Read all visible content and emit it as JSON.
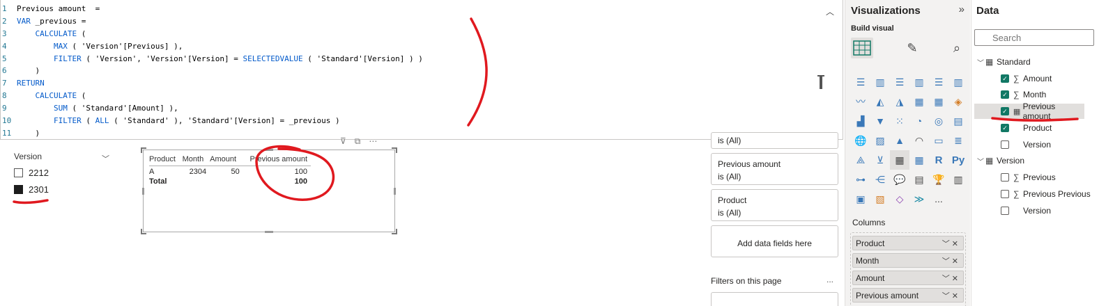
{
  "editor": {
    "lines": [
      {
        "n": "1",
        "parts": [
          [
            "t",
            "Previous amount  ="
          ]
        ]
      },
      {
        "n": "2",
        "parts": [
          [
            "kw",
            "VAR"
          ],
          [
            "t",
            " _previous ="
          ]
        ]
      },
      {
        "n": "3",
        "parts": [
          [
            "t",
            "    "
          ],
          [
            "fn",
            "CALCULATE"
          ],
          [
            "t",
            " ("
          ]
        ]
      },
      {
        "n": "4",
        "parts": [
          [
            "t",
            "        "
          ],
          [
            "fn",
            "MAX"
          ],
          [
            "t",
            " ( 'Version'[Previous] ),"
          ]
        ]
      },
      {
        "n": "5",
        "parts": [
          [
            "t",
            "        "
          ],
          [
            "fn",
            "FILTER"
          ],
          [
            "t",
            " ( 'Version', 'Version'[Version] = "
          ],
          [
            "fn",
            "SELECTEDVALUE"
          ],
          [
            "t",
            " ( 'Standard'[Version] ) )"
          ]
        ]
      },
      {
        "n": "6",
        "parts": [
          [
            "t",
            "    )"
          ]
        ]
      },
      {
        "n": "7",
        "parts": [
          [
            "kw",
            "RETURN"
          ]
        ]
      },
      {
        "n": "8",
        "parts": [
          [
            "t",
            "    "
          ],
          [
            "fn",
            "CALCULATE"
          ],
          [
            "t",
            " ("
          ]
        ]
      },
      {
        "n": "9",
        "parts": [
          [
            "t",
            "        "
          ],
          [
            "fn",
            "SUM"
          ],
          [
            "t",
            " ( 'Standard'[Amount] ),"
          ]
        ]
      },
      {
        "n": "10",
        "parts": [
          [
            "t",
            "        "
          ],
          [
            "fn",
            "FILTER"
          ],
          [
            "t",
            " ( "
          ],
          [
            "fn",
            "ALL"
          ],
          [
            "t",
            " ( 'Standard' ), 'Standard'[Version] = _previous )"
          ]
        ]
      },
      {
        "n": "11",
        "parts": [
          [
            "t",
            "    )"
          ]
        ]
      }
    ]
  },
  "slicer": {
    "title": "Version",
    "items": [
      {
        "label": "2212",
        "checked": false
      },
      {
        "label": "2301",
        "checked": true
      }
    ]
  },
  "table_visual": {
    "headers": [
      "Product",
      "Month",
      "Amount",
      "Previous amount"
    ],
    "rows": [
      [
        "A",
        "2304",
        "50",
        "100"
      ]
    ],
    "total": {
      "label": "Total",
      "value": "100"
    }
  },
  "filters": {
    "card1_line2": "is (All)",
    "card2_title": "Previous amount",
    "card2_value": "is (All)",
    "card3_title": "Product",
    "card3_value": "is (All)",
    "add_fields": "Add data fields here",
    "on_page": "Filters on this page",
    "more": "..."
  },
  "visualizations": {
    "title": "Visualizations",
    "expand": "»",
    "build_visual": "Build visual",
    "columns_label": "Columns",
    "columns": [
      "Product",
      "Month",
      "Amount",
      "Previous amount"
    ],
    "more": "..."
  },
  "data_pane": {
    "title": "Data",
    "search_placeholder": "Search",
    "tables": [
      {
        "name": "Standard",
        "fields": [
          {
            "name": "Amount",
            "checked": true,
            "type": "sigma"
          },
          {
            "name": "Month",
            "checked": true,
            "type": "sigma"
          },
          {
            "name": "Previous amount",
            "checked": true,
            "type": "calc"
          },
          {
            "name": "Product",
            "checked": true,
            "type": "text"
          },
          {
            "name": "Version",
            "checked": false,
            "type": "text"
          }
        ]
      },
      {
        "name": "Version",
        "fields": [
          {
            "name": "Previous",
            "checked": false,
            "type": "sigma"
          },
          {
            "name": "Previous Previous",
            "checked": false,
            "type": "sigma"
          },
          {
            "name": "Version",
            "checked": false,
            "type": "text"
          }
        ]
      }
    ]
  },
  "colors": {
    "accent": "#117865",
    "ink": "#e0191f",
    "keyword": "#035aca"
  }
}
